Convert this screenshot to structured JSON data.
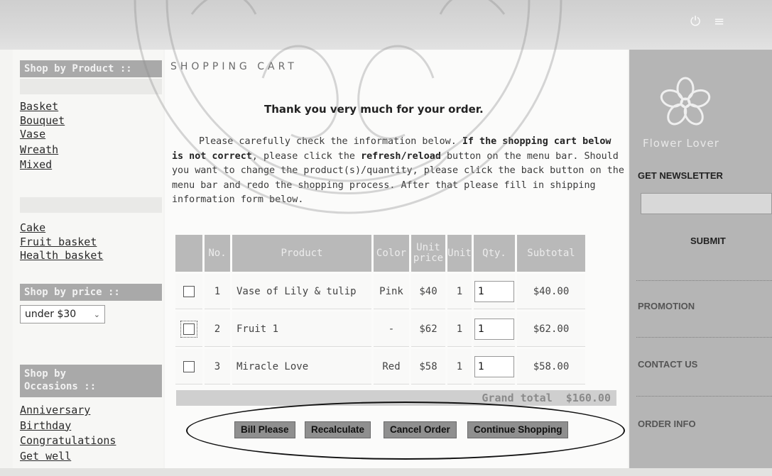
{
  "sidebar": {
    "shop_by_product_label": "Shop by Product ::",
    "product_links": [
      "Basket",
      "Bouquet",
      "Vase",
      "Wreath",
      "Mixed"
    ],
    "other_links": [
      "Cake",
      "Fruit basket",
      "Health basket"
    ],
    "shop_by_price_label": "Shop by price ::",
    "price_select_value": "under $30",
    "shop_by_occasions_label_line1": "Shop by",
    "shop_by_occasions_label_line2": "Occasions ::",
    "occasion_links": [
      "Anniversary",
      "Birthday",
      "Congratulations",
      "Get well"
    ]
  },
  "main": {
    "cart_heading": "SHOPPING CART",
    "thanks": "Thank you very much for your order.",
    "info_part1": "Please carefully check the information below. ",
    "info_bold1": "If the shopping cart below is not correct",
    "info_part2": ", please click the ",
    "info_bold2": "refresh/reload",
    "info_part3": " button on the menu bar. Should you want to change the product(s)/quantity, please click the back button on the menu bar and redo the shopping process. After that please fill in shipping information form below."
  },
  "table": {
    "headers": [
      "",
      "No.",
      "Product",
      "Color",
      "Unit price",
      "Unit",
      "Qty.",
      "Subtotal"
    ],
    "rows": [
      {
        "no": "1",
        "product": "Vase of Lily & tulip",
        "color": "Pink",
        "price": "$40",
        "unit": "1",
        "qty": "1",
        "subtotal": "$40.00"
      },
      {
        "no": "2",
        "product": "Fruit 1",
        "color": "-",
        "price": "$62",
        "unit": "1",
        "qty": "1",
        "subtotal": "$62.00"
      },
      {
        "no": "3",
        "product": "Miracle Love",
        "color": "Red",
        "price": "$58",
        "unit": "1",
        "qty": "1",
        "subtotal": "$58.00"
      }
    ],
    "grand_total_label": "Grand total",
    "grand_total_value": "$160.00"
  },
  "buttons": {
    "bill": "Bill Please",
    "recalculate": "Recalculate",
    "cancel": "Cancel Order",
    "continue": "Continue Shopping"
  },
  "right": {
    "brand": "Flower Lover",
    "newsletter_label": "GET NEWSLETTER",
    "submit_label": "SUBMIT",
    "promotion_label": "PROMOTION",
    "contact_label": "CONTACT US",
    "order_info_label": "ORDER INFO"
  }
}
